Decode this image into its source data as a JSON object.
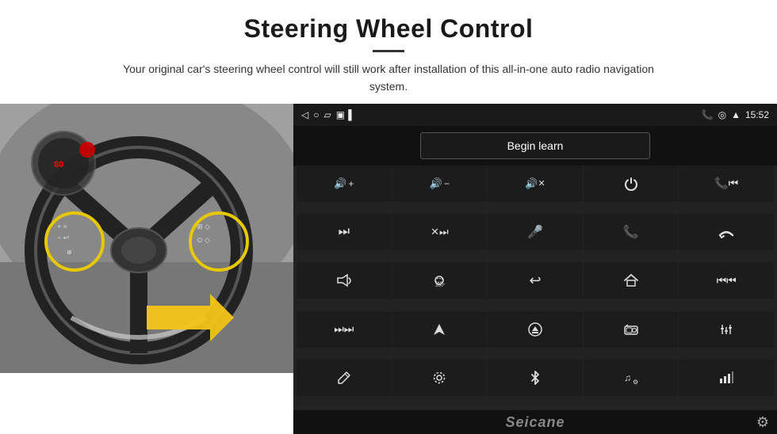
{
  "header": {
    "title": "Steering Wheel Control",
    "subtitle": "Your original car's steering wheel control will still work after installation of this all-in-one auto radio navigation system."
  },
  "status_bar": {
    "time": "15:52",
    "back_icon": "◁",
    "home_icon": "□",
    "square_icon": "▱",
    "signal_icon": "▣▐",
    "phone_icon": "📞",
    "location_icon": "⊙",
    "wifi_icon": "▲"
  },
  "begin_learn": {
    "label": "Begin learn"
  },
  "controls": [
    {
      "icon": "🔊+",
      "name": "vol-up"
    },
    {
      "icon": "🔊−",
      "name": "vol-down"
    },
    {
      "icon": "🔇",
      "name": "mute"
    },
    {
      "icon": "⏻",
      "name": "power"
    },
    {
      "icon": "⏮",
      "name": "prev-track-end"
    },
    {
      "icon": "⏭",
      "name": "next"
    },
    {
      "icon": "✂⏭",
      "name": "skip-fast"
    },
    {
      "icon": "🎤",
      "name": "mic"
    },
    {
      "icon": "📞",
      "name": "call"
    },
    {
      "icon": "↩",
      "name": "hang-up"
    },
    {
      "icon": "📢",
      "name": "horn"
    },
    {
      "icon": "360°",
      "name": "360-cam"
    },
    {
      "icon": "↩",
      "name": "back"
    },
    {
      "icon": "🏠",
      "name": "home"
    },
    {
      "icon": "⏮⏮",
      "name": "fast-back"
    },
    {
      "icon": "⏭⏭",
      "name": "fast-fwd"
    },
    {
      "icon": "◀",
      "name": "nav"
    },
    {
      "icon": "⏏",
      "name": "eject"
    },
    {
      "icon": "📻",
      "name": "radio"
    },
    {
      "icon": "|||",
      "name": "eq"
    },
    {
      "icon": "✏",
      "name": "pen"
    },
    {
      "icon": "⚙",
      "name": "settings-sm"
    },
    {
      "icon": "✦",
      "name": "bluetooth"
    },
    {
      "icon": "♫⚙",
      "name": "music-settings"
    },
    {
      "icon": "📶",
      "name": "signal"
    }
  ],
  "branding": {
    "logo": "Seicane"
  },
  "footer": {
    "gear_icon": "⚙"
  }
}
